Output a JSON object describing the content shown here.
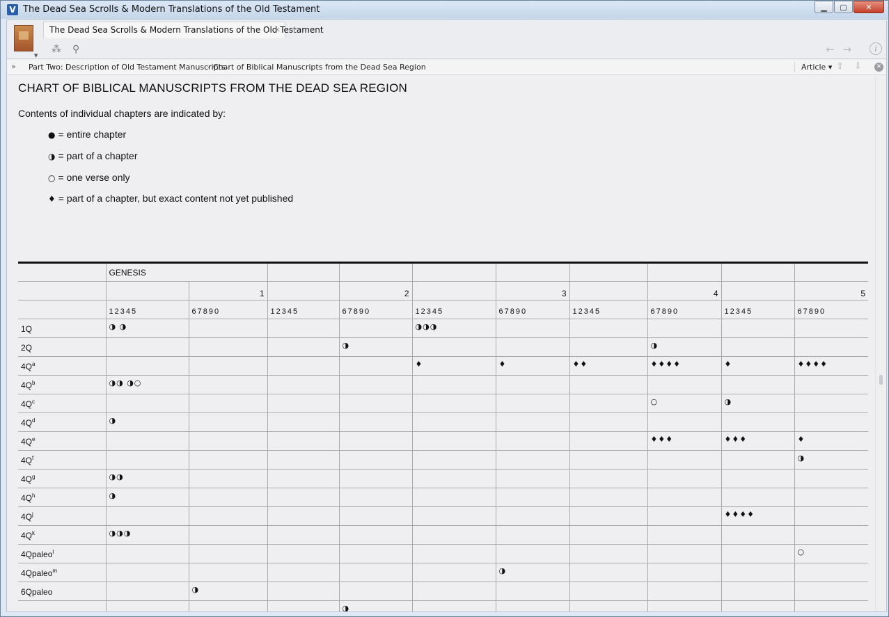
{
  "window": {
    "title": "The Dead Sea Scrolls & Modern Translations of the Old Testament",
    "icon_letter": "V"
  },
  "tabs": [
    {
      "label": "The Dead Sea Scrolls & Modern Translations of the Old Testament",
      "close": "×"
    }
  ],
  "tab_add": "+",
  "breadcrumb": {
    "expand": "»",
    "items": [
      "Part Two: Description of Old Testament Manuscripts",
      "Chart of Biblical Manuscripts from the Dead Sea Region"
    ],
    "separator": "›"
  },
  "view_menu": "Article ▾",
  "content": {
    "title": "CHART OF BIBLICAL MANUSCRIPTS FROM THE DEAD SEA REGION",
    "intro": "Contents of individual chapters are indicated by:",
    "legend": [
      {
        "symbol": "●",
        "text": "= entire chapter"
      },
      {
        "symbol": "◑",
        "text": "= part of a chapter"
      },
      {
        "symbol": "○",
        "text": "= one verse only"
      },
      {
        "symbol": "♦",
        "text": "= part of a chapter, but exact content not yet published"
      }
    ]
  },
  "table": {
    "book": "GENESIS",
    "decades": [
      "",
      "1",
      "",
      "2",
      "",
      "3",
      "",
      "4",
      "",
      "5"
    ],
    "digit_groups": [
      "12345",
      "67890",
      "12345",
      "67890",
      "12345",
      "67890",
      "12345",
      "67890",
      "12345",
      "67890"
    ],
    "rows": [
      {
        "base": "1Q",
        "sup": "",
        "cells": [
          "◑ ◑",
          "",
          "",
          "",
          "◑◑◑",
          "",
          "",
          "",
          "",
          ""
        ]
      },
      {
        "base": "2Q",
        "sup": "",
        "cells": [
          "",
          "",
          "",
          "◑",
          "",
          "",
          "",
          "◑",
          "",
          ""
        ]
      },
      {
        "base": "4Q",
        "sup": "a",
        "cells": [
          "",
          "",
          "",
          "",
          "♦",
          "♦",
          "♦♦",
          "♦♦♦♦",
          "♦",
          "♦♦♦♦"
        ]
      },
      {
        "base": "4Q",
        "sup": "b",
        "cells": [
          "◑◑ ◑○",
          "",
          "",
          "",
          "",
          "",
          "",
          "",
          "",
          ""
        ]
      },
      {
        "base": "4Q",
        "sup": "c",
        "cells": [
          "",
          "",
          "",
          "",
          "",
          "",
          "",
          "○",
          "◑",
          ""
        ]
      },
      {
        "base": "4Q",
        "sup": "d",
        "cells": [
          "◑",
          "",
          "",
          "",
          "",
          "",
          "",
          "",
          "",
          ""
        ]
      },
      {
        "base": "4Q",
        "sup": "e",
        "cells": [
          "",
          "",
          "",
          "",
          "",
          "",
          "",
          "♦♦♦",
          "♦♦♦",
          "♦"
        ]
      },
      {
        "base": "4Q",
        "sup": "f",
        "cells": [
          "",
          "",
          "",
          "",
          "",
          "",
          "",
          "",
          "",
          "◑"
        ]
      },
      {
        "base": "4Q",
        "sup": "g",
        "cells": [
          "◑◑",
          "",
          "",
          "",
          "",
          "",
          "",
          "",
          "",
          ""
        ]
      },
      {
        "base": "4Q",
        "sup": "h",
        "cells": [
          "◑",
          "",
          "",
          "",
          "",
          "",
          "",
          "",
          "",
          ""
        ]
      },
      {
        "base": "4Q",
        "sup": "j",
        "cells": [
          "",
          "",
          "",
          "",
          "",
          "",
          "",
          "",
          "♦♦♦♦",
          ""
        ]
      },
      {
        "base": "4Q",
        "sup": "k",
        "cells": [
          "◑◑◑",
          "",
          "",
          "",
          "",
          "",
          "",
          "",
          "",
          ""
        ]
      },
      {
        "base": "4Qpaleo",
        "sup": "l",
        "cells": [
          "",
          "",
          "",
          "",
          "",
          "",
          "",
          "",
          "",
          "○"
        ]
      },
      {
        "base": "4Qpaleo",
        "sup": "m",
        "cells": [
          "",
          "",
          "",
          "",
          "",
          "◑",
          "",
          "",
          "",
          ""
        ]
      },
      {
        "base": "6Qpaleo",
        "sup": "",
        "cells": [
          "",
          "◑",
          "",
          "",
          "",
          "",
          "",
          "",
          "",
          ""
        ]
      },
      {
        "base": "",
        "sup": "",
        "cells": [
          "",
          "",
          "",
          "◑",
          "",
          "",
          "",
          "",
          "",
          ""
        ]
      }
    ]
  },
  "icons": {
    "app": "v-logo-icon",
    "resources": "cluster-icon",
    "search": "search-icon",
    "back": "back-arrow-icon",
    "forward": "forward-arrow-icon",
    "info": "info-icon"
  }
}
